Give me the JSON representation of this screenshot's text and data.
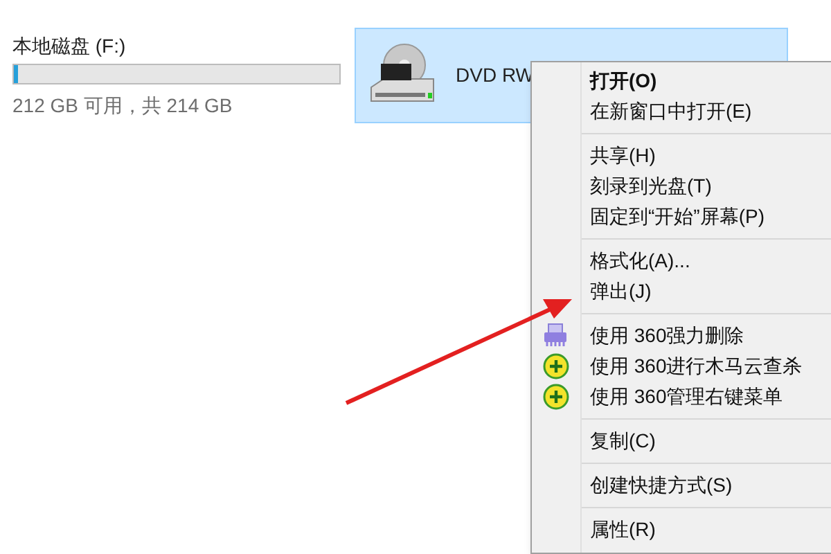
{
  "drives": [
    {
      "name": "本地磁盘 (F:)",
      "level": 0.012,
      "free_text": "212 GB 可用，共 214 GB"
    }
  ],
  "dvd_drive": {
    "name": "DVD RW",
    "selected": true
  },
  "context_menu": [
    {
      "kind": "item",
      "label": "打开(O)",
      "default": true
    },
    {
      "kind": "item",
      "label": "在新窗口中打开(E)",
      "default": false
    },
    {
      "kind": "separator"
    },
    {
      "kind": "item",
      "label": "共享(H)",
      "default": false
    },
    {
      "kind": "item",
      "label": "刻录到光盘(T)",
      "default": false
    },
    {
      "kind": "item",
      "label": "固定到“开始”屏幕(P)",
      "default": false
    },
    {
      "kind": "separator"
    },
    {
      "kind": "item",
      "label": "格式化(A)...",
      "default": false
    },
    {
      "kind": "item",
      "label": "弹出(J)",
      "default": false
    },
    {
      "kind": "separator"
    },
    {
      "kind": "shredder_item",
      "label": "使用 360强力删除",
      "default": false
    },
    {
      "kind": "plus_item",
      "label": "使用 360进行木马云查杀",
      "default": false
    },
    {
      "kind": "plus_item",
      "label": "使用 360管理右键菜单",
      "default": false
    },
    {
      "kind": "separator"
    },
    {
      "kind": "item",
      "label": "复制(C)",
      "default": false
    },
    {
      "kind": "separator"
    },
    {
      "kind": "item",
      "label": "创建快捷方式(S)",
      "default": false
    },
    {
      "kind": "separator"
    },
    {
      "kind": "item",
      "label": "属性(R)",
      "default": false
    }
  ]
}
